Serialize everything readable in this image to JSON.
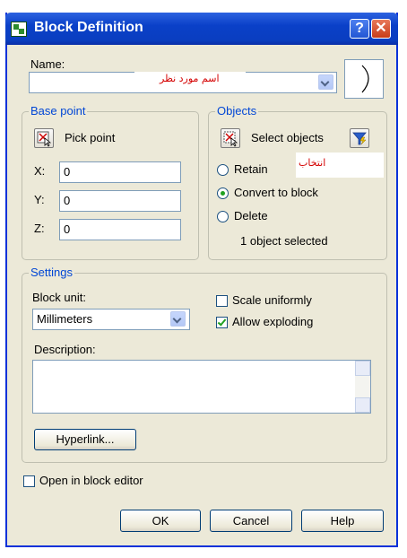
{
  "window": {
    "title": "Block Definition",
    "help_glyph": "?",
    "close_glyph": "✕"
  },
  "name": {
    "label": "Name:",
    "value": "",
    "annotation": "اسم مورد نظر"
  },
  "base_point": {
    "title": "Base point",
    "pick_label": "Pick point",
    "x_label": "X:",
    "x_value": "0",
    "y_label": "Y:",
    "y_value": "0",
    "z_label": "Z:",
    "z_value": "0"
  },
  "objects": {
    "title": "Objects",
    "select_label": "Select objects",
    "annotation": "انتخاب",
    "retain": "Retain",
    "convert": "Convert to block",
    "delete": "Delete",
    "status": "1 object selected",
    "selected_option": "convert"
  },
  "settings": {
    "title": "Settings",
    "block_unit_label": "Block unit:",
    "block_unit_value": "Millimeters",
    "scale_uniformly": "Scale uniformly",
    "scale_uniformly_checked": false,
    "allow_exploding": "Allow exploding",
    "allow_exploding_checked": true,
    "description_label": "Description:",
    "description_value": "",
    "hyperlink": "Hyperlink..."
  },
  "open_in_editor": {
    "label": "Open in block editor",
    "checked": false
  },
  "buttons": {
    "ok": "OK",
    "cancel": "Cancel",
    "help": "Help"
  },
  "colors": {
    "title_bar": "#0a40c8",
    "dialog_bg": "#ece9d8",
    "group_title": "#0046d5",
    "annotation": "#d40000",
    "check_mark": "#21a121"
  }
}
